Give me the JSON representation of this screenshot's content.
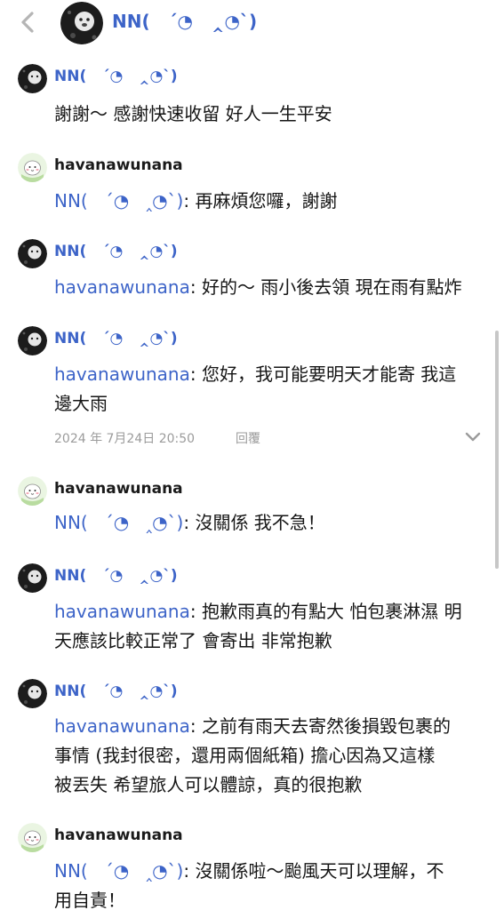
{
  "header": {
    "back_icon": "chevron-left-icon",
    "title": "NN(   ´◔   ‸◔`)"
  },
  "messages": [
    {
      "user": "NN(   ´◔   ‸◔`)",
      "avatar": "dark-avatar",
      "mention": "",
      "text": "謝謝～ 感謝快速收留 好人一生平安"
    },
    {
      "user": "havanawunana",
      "avatar": "cartoon-avatar",
      "mention": "NN(   ´◔   ‸◔`)",
      "text": ": 再麻煩您囉，謝謝"
    },
    {
      "user": "NN(   ´◔   ‸◔`)",
      "avatar": "dark-avatar",
      "mention": "havanawunana",
      "text": ": 好的～ 雨小後去領 現在雨有點炸"
    },
    {
      "user": "NN(   ´◔   ‸◔`)",
      "avatar": "dark-avatar",
      "mention": "havanawunana",
      "text": ": 您好，我可能要明天才能寄 我這\n邊大雨",
      "timestamp": "2024 年 7月24日 20:50",
      "reply_label": "回覆"
    },
    {
      "user": "havanawunana",
      "avatar": "cartoon-avatar",
      "mention": "NN(   ´◔   ‸◔`)",
      "text": ": 沒關係 我不急！"
    },
    {
      "user": "NN(   ´◔   ‸◔`)",
      "avatar": "dark-avatar",
      "mention": "havanawunana",
      "text": ": 抱歉雨真的有點大 怕包裹淋濕 明\n天應該比較正常了 會寄出 非常抱歉"
    },
    {
      "user": "NN(   ´◔   ‸◔`)",
      "avatar": "dark-avatar",
      "mention": "havanawunana",
      "text": ": 之前有雨天去寄然後損毀包裹的\n事情 (我封很密，還用兩個紙箱) 擔心因為又這樣\n被丟失 希望旅人可以體諒，真的很抱歉"
    },
    {
      "user": "havanawunana",
      "avatar": "cartoon-avatar",
      "mention": "NN(   ´◔   ‸◔`)",
      "text": ": 沒關係啦～颱風天可以理解，不\n用自責！"
    }
  ]
}
